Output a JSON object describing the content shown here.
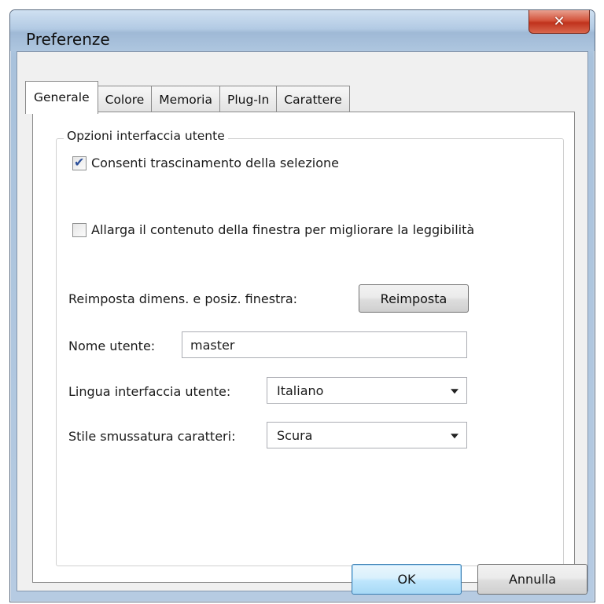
{
  "window": {
    "title": "Preferenze",
    "close_glyph": "✕"
  },
  "tabs": [
    {
      "label": "Generale",
      "active": true
    },
    {
      "label": "Colore",
      "active": false
    },
    {
      "label": "Memoria",
      "active": false
    },
    {
      "label": "Plug-In",
      "active": false
    },
    {
      "label": "Carattere",
      "active": false
    }
  ],
  "group": {
    "legend": "Opzioni interfaccia utente",
    "drag_selection": {
      "label": "Consenti trascinamento della selezione",
      "checked": true
    },
    "enlarge_content": {
      "label": "Allarga il contenuto della finestra per migliorare la leggibilità",
      "checked": false
    },
    "reset": {
      "label": "Reimposta dimens. e posiz. finestra:",
      "button": "Reimposta"
    },
    "username": {
      "label": "Nome utente:",
      "value": "master"
    },
    "language": {
      "label": "Lingua interfaccia utente:",
      "value": "Italiano"
    },
    "smoothing": {
      "label": "Stile smussatura caratteri:",
      "value": "Scura"
    }
  },
  "footer": {
    "ok": "OK",
    "cancel": "Annulla"
  },
  "colors": {
    "close_red": "#c0321c",
    "ok_blue": "#3c7fb1",
    "check_blue": "#2c4f9a"
  }
}
